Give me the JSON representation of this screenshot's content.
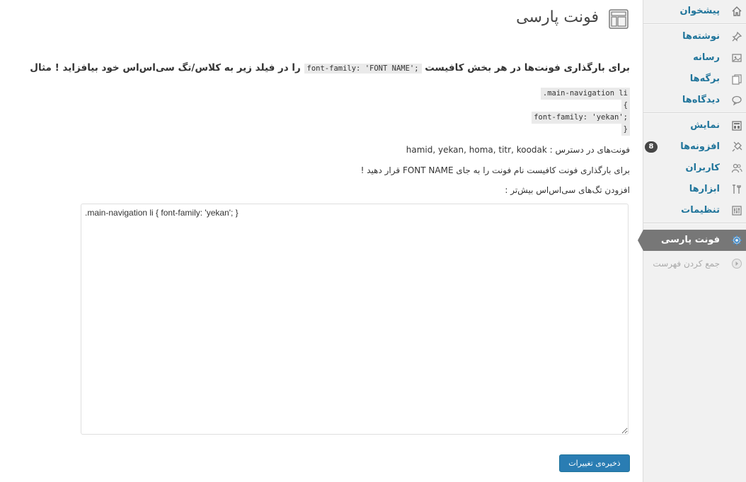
{
  "sidebar": {
    "items": [
      {
        "label": "پیشخوان",
        "icon": "home-icon"
      },
      {
        "label": "نوشته‌ها",
        "icon": "pin-icon"
      },
      {
        "label": "رسانه",
        "icon": "media-icon"
      },
      {
        "label": "برگه‌ها",
        "icon": "pages-icon"
      },
      {
        "label": "دیدگاه‌ها",
        "icon": "comment-icon"
      },
      {
        "label": "نمایش",
        "icon": "appearance-icon"
      },
      {
        "label": "افزونه‌ها",
        "icon": "plugin-icon",
        "badge": "8"
      },
      {
        "label": "کاربران",
        "icon": "users-icon"
      },
      {
        "label": "ابزارها",
        "icon": "tools-icon"
      },
      {
        "label": "تنظیمات",
        "icon": "settings-icon"
      },
      {
        "label": "فونت پارسی",
        "icon": "gear-icon"
      },
      {
        "label": "جمع کردن فهرست",
        "icon": "collapse-icon"
      }
    ],
    "current_color": "#777777",
    "link_color": "#21759b"
  },
  "main": {
    "title": "فونت پارسی",
    "heading_part1": "برای بارگذاری فونت‌ها در هر بخش کافیست",
    "heading_code": "font-family: 'FONT NAME';",
    "heading_part2": "را در فیلد زیر به کلاس/تگ سی‌اس‌اس خود بیافزاید ! مثال",
    "example": {
      "line1": ".main-navigation li",
      "line2": "{",
      "line3": "font-family: 'yekan';",
      "line4": "}"
    },
    "available_fonts": "فونت‌های در دسترس : hamid, yekan, homa, titr, koodak",
    "instruction": "برای بارگذاری فونت کافیست نام فونت را به جای FONT NAME قرار دهید !",
    "more_css_label": "افزودن تگ‌های سی‌اس‌اس بیش‌تر :",
    "css_value": ".main-navigation li { font-family: 'yekan'; }",
    "save_label": "ذخیره‌ی تغییرات",
    "button_color": "#2a7db3"
  }
}
